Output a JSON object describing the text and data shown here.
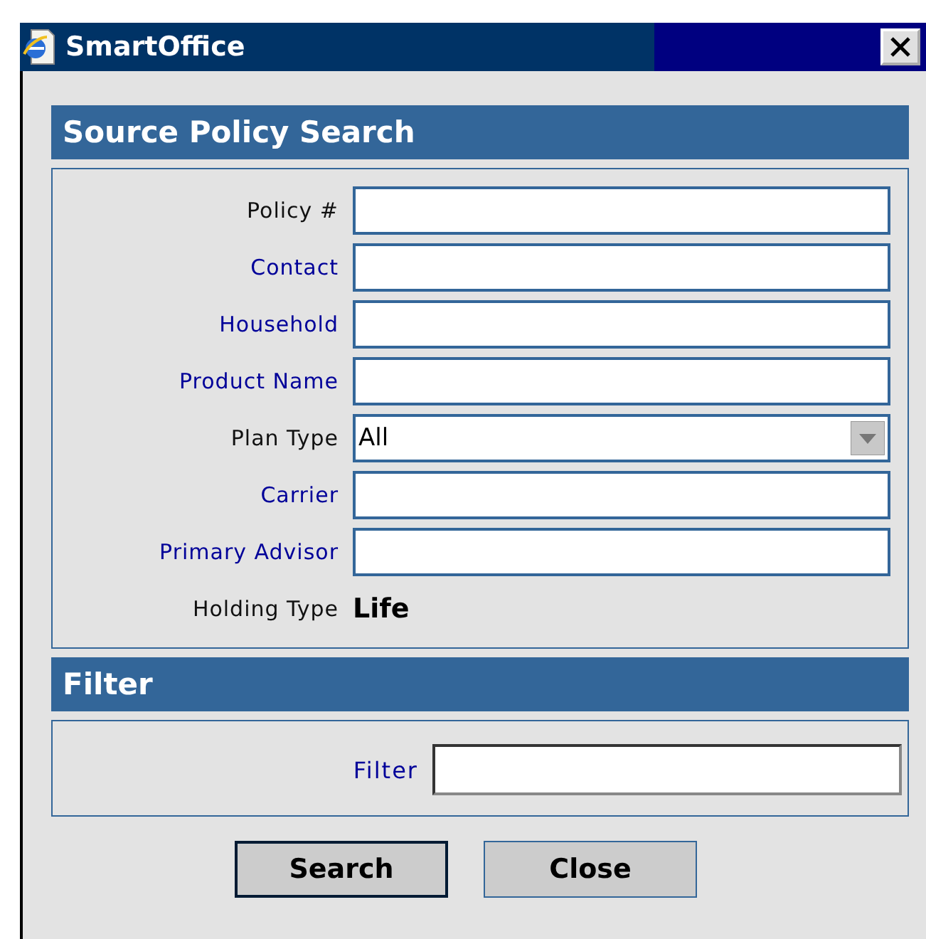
{
  "window": {
    "title": "SmartOffice"
  },
  "search_section": {
    "title": "Source Policy Search",
    "fields": [
      {
        "label": "Policy #",
        "kind": "text",
        "link": false
      },
      {
        "label": "Contact",
        "kind": "text",
        "link": true
      },
      {
        "label": "Household",
        "kind": "text",
        "link": true
      },
      {
        "label": "Product Name",
        "kind": "text",
        "link": true
      },
      {
        "label": "Plan Type",
        "kind": "select",
        "link": false,
        "value": "All"
      },
      {
        "label": "Carrier",
        "kind": "text",
        "link": true
      },
      {
        "label": "Primary Advisor",
        "kind": "text",
        "link": true
      },
      {
        "label": "Holding Type",
        "kind": "static",
        "link": false,
        "value": "Life"
      }
    ]
  },
  "filter_section": {
    "title": "Filter",
    "label": "Filter"
  },
  "buttons": [
    {
      "label": "Search",
      "default": true
    },
    {
      "label": "Close",
      "default": false
    }
  ]
}
